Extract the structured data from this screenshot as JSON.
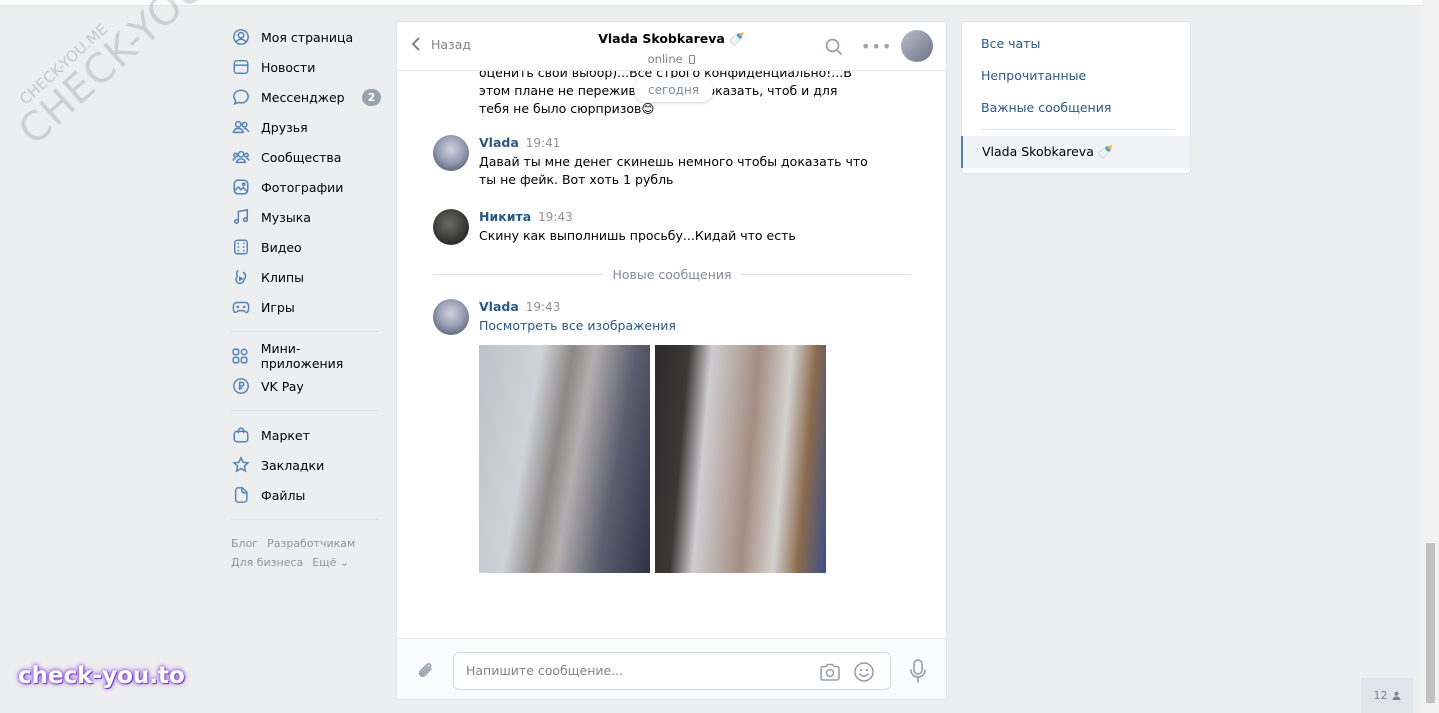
{
  "watermarks": {
    "big": "CHECK-YOU.ME",
    "small": "CHECK-YOU.ME",
    "brand": "check-you.to"
  },
  "nav": {
    "items": [
      {
        "label": "Моя страница",
        "icon": "user-icon"
      },
      {
        "label": "Новости",
        "icon": "news-icon"
      },
      {
        "label": "Мессенджер",
        "icon": "message-icon",
        "badge": "2"
      },
      {
        "label": "Друзья",
        "icon": "friends-icon"
      },
      {
        "label": "Сообщества",
        "icon": "groups-icon"
      },
      {
        "label": "Фотографии",
        "icon": "photo-icon"
      },
      {
        "label": "Музыка",
        "icon": "music-icon"
      },
      {
        "label": "Видео",
        "icon": "video-icon"
      },
      {
        "label": "Клипы",
        "icon": "clips-icon"
      },
      {
        "label": "Игры",
        "icon": "games-icon"
      }
    ],
    "items2": [
      {
        "label": "Мини-приложения",
        "icon": "apps-icon"
      },
      {
        "label": "VK Pay",
        "icon": "vkpay-icon"
      }
    ],
    "items3": [
      {
        "label": "Маркет",
        "icon": "market-icon"
      },
      {
        "label": "Закладки",
        "icon": "star-icon"
      },
      {
        "label": "Файлы",
        "icon": "file-icon"
      }
    ],
    "footer": [
      "Блог",
      "Разработчикам",
      "Для бизнеса",
      "Ещё ⌄"
    ]
  },
  "chat": {
    "back_label": "Назад",
    "peer_name": "Vlada Skobkareva 🍼",
    "peer_status": "online",
    "date_pill": "сегодня",
    "cut_message": "оценить свой выбор)...Все строго конфиденциально!...В этом плане не переживай...Себя показать, чтоб и для тебя не было сюрпризов😊",
    "messages": [
      {
        "author": "Vlada",
        "time": "19:41",
        "text": "Давай ты мне денег скинешь немного чтобы доказать что ты не фейк. Вот хоть 1 рубль"
      },
      {
        "author": "Никита",
        "time": "19:43",
        "text": "Скину как выполнишь просьбу...Кидай что есть"
      },
      {
        "author": "Vlada",
        "time": "19:43",
        "text": "Посмотреть все изображения"
      }
    ],
    "new_messages_label": "Новые сообщения",
    "composer_placeholder": "Напишите сообщение..."
  },
  "right_panel": {
    "items": [
      "Все чаты",
      "Непрочитанные",
      "Важные сообщения"
    ],
    "active_chat": "Vlada Skobkareva 🍼"
  },
  "corner": {
    "count": "12"
  },
  "colors": {
    "accent": "#5181b8",
    "link": "#2a5885",
    "bg": "#edeef0"
  }
}
